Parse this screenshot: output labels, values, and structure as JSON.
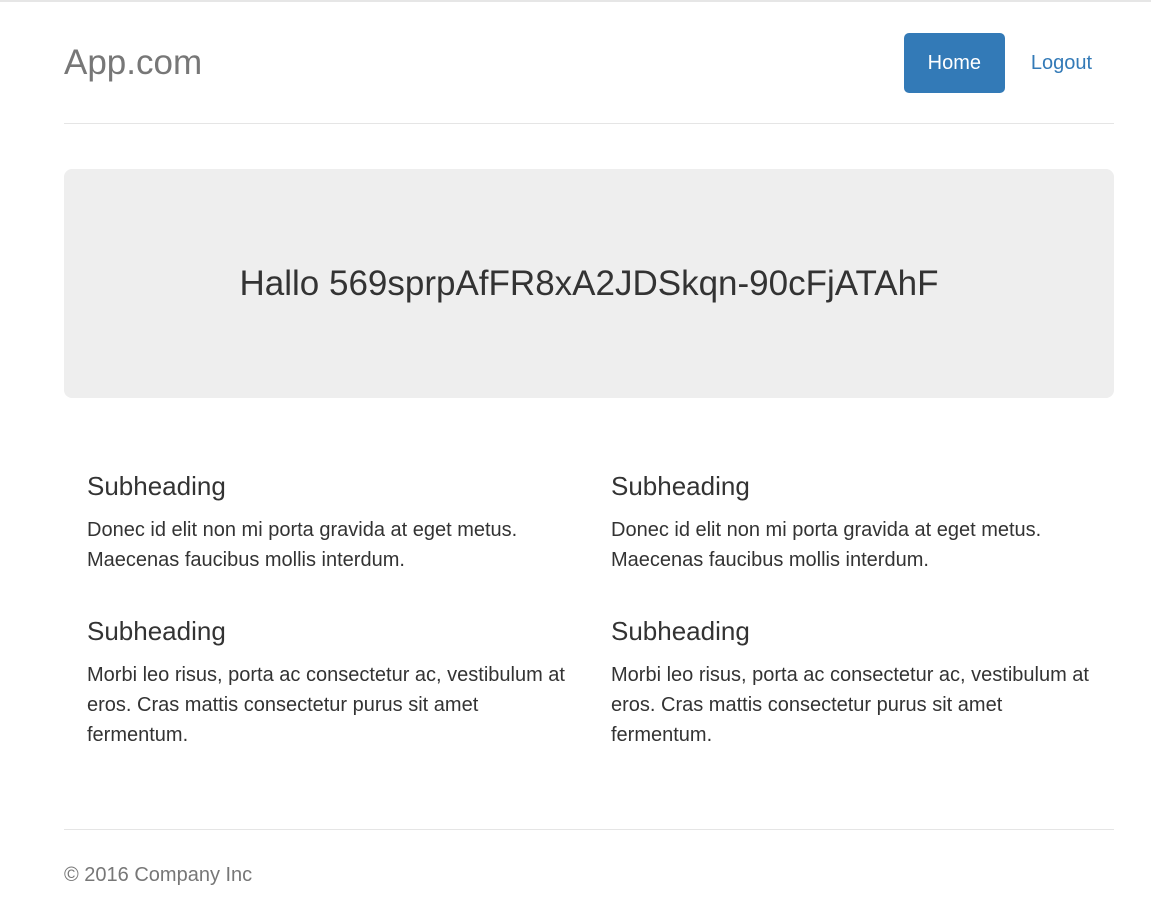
{
  "header": {
    "brand": "App.com",
    "nav": [
      {
        "label": "Home",
        "active": true
      },
      {
        "label": "Logout",
        "active": false
      }
    ]
  },
  "jumbotron": {
    "greeting": "Hallo 569sprpAfFR8xA2JDSkqn-90cFjATAhF"
  },
  "marketing": {
    "left": [
      {
        "heading": "Subheading",
        "text": "Donec id elit non mi porta gravida at eget metus. Maecenas faucibus mollis interdum."
      },
      {
        "heading": "Subheading",
        "text": "Morbi leo risus, porta ac consectetur ac, vestibulum at eros. Cras mattis consectetur purus sit amet fermentum."
      }
    ],
    "right": [
      {
        "heading": "Subheading",
        "text": "Donec id elit non mi porta gravida at eget metus. Maecenas faucibus mollis interdum."
      },
      {
        "heading": "Subheading",
        "text": "Morbi leo risus, porta ac consectetur ac, vestibulum at eros. Cras mattis consectetur purus sit amet fermentum."
      }
    ]
  },
  "footer": {
    "copyright": "© 2016 Company Inc"
  },
  "colors": {
    "primary": "#337ab7",
    "jumbotron_bg": "#eeeeee",
    "muted": "#777777"
  }
}
